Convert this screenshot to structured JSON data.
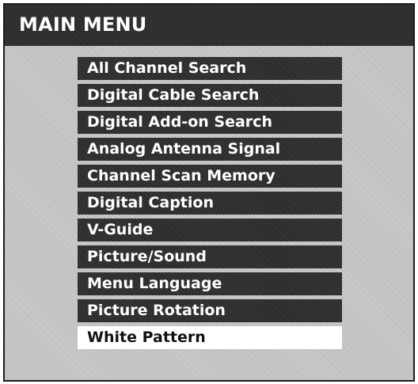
{
  "title": "MAIN MENU",
  "menu": {
    "items": [
      {
        "label": "All Channel Search",
        "selected": false
      },
      {
        "label": "Digital Cable Search",
        "selected": false
      },
      {
        "label": "Digital Add-on Search",
        "selected": false
      },
      {
        "label": "Analog Antenna Signal",
        "selected": false
      },
      {
        "label": "Channel Scan Memory",
        "selected": false
      },
      {
        "label": "Digital Caption",
        "selected": false
      },
      {
        "label": "V-Guide",
        "selected": false
      },
      {
        "label": "Picture/Sound",
        "selected": false
      },
      {
        "label": "Menu Language",
        "selected": false
      },
      {
        "label": "Picture Rotation",
        "selected": false
      },
      {
        "label": "White Pattern",
        "selected": true
      }
    ]
  },
  "colors": {
    "title_bar": "#2f2f2f",
    "item_background": "#303030",
    "selected_background": "#ffffff",
    "screen_background": "#c7c7c7"
  }
}
